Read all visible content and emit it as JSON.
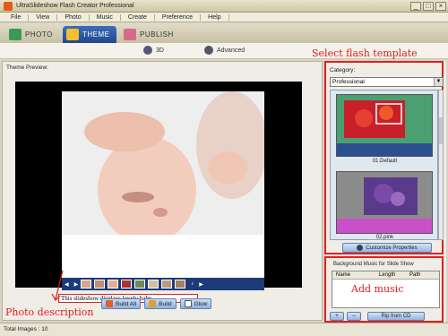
{
  "window": {
    "title": "UltraSlideshow Flash Creator Professional"
  },
  "menu": [
    "File",
    "View",
    "Photo",
    "Music",
    "Create",
    "Preference",
    "Help"
  ],
  "tabs": [
    {
      "label": "Photo",
      "icon": "photo-icon",
      "active": false
    },
    {
      "label": "Theme",
      "icon": "theme-icon",
      "active": true
    },
    {
      "label": "Publish",
      "icon": "publish-icon",
      "active": false
    }
  ],
  "modes": [
    {
      "label": "3D",
      "icon": "3d-mode-icon"
    },
    {
      "label": "Advanced",
      "icon": "advanced-mode-icon"
    }
  ],
  "preview": {
    "label": "Theme Preview:",
    "caption": "This slideshow displays lovely baby"
  },
  "actions": [
    "Build All",
    "Build",
    "Glow"
  ],
  "status": {
    "total_images": "Total Images : 10"
  },
  "annotations": {
    "select_template": "Select flash template",
    "photo_description": "Photo description",
    "add_music": "Add music"
  },
  "template_panel": {
    "category_label": "Category:",
    "category_value": "Professional",
    "templates": [
      {
        "name": "01.Default"
      },
      {
        "name": "02.pink"
      }
    ],
    "customize_button": "Customize Properties"
  },
  "music_panel": {
    "label": "Background Music for Slide Show",
    "columns": [
      "Name",
      "Length",
      "Path"
    ],
    "add_button": "+",
    "remove_button": "–",
    "rip_button": "Rip from CD"
  },
  "colors": {
    "accent": "#2b4f9a",
    "annotation": "#e01b1b",
    "highlight_border": "#e02020"
  }
}
